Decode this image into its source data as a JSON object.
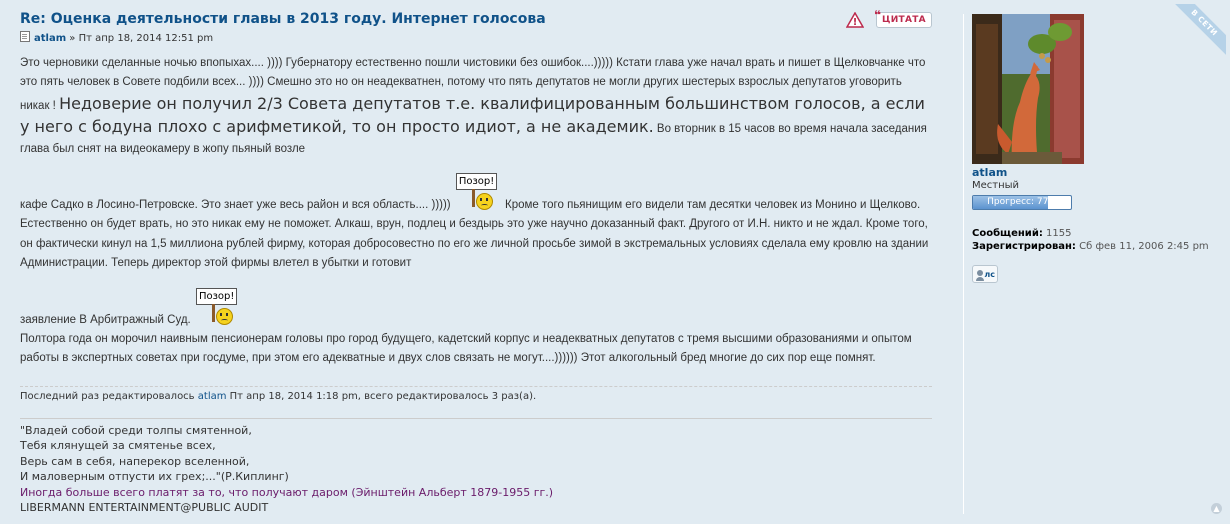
{
  "post": {
    "title": "Re: Оценка деятельности главы в 2013 году. Интернет голосова",
    "author": "atlam",
    "date_sep": " » ",
    "date": "Пт апр 18, 2014 12:51 pm",
    "quote_label": "ЦИТАТА",
    "report_label": "!",
    "content": {
      "p1": "Это черновики сделанные ночью впопыхах.... )))) Губернатору естественно пошли чистовики без ошибок....))))) Кстати глава уже начал врать и пишет в Щелковчанке что это пять человек в Совете подбили всех... )))) Смешно это но он неадекватнен, потому что пять депутатов не могли других шестерых взрослых депутатов уговорить никак ! ",
      "p1_big": "Недоверие он получил 2/3 Совета депутатов т.е. квалифицированным большинством голосов, а если у него с бодуна плохо с арифметикой, то он просто идиот, а не академик.",
      "p1_tail": " Во вторник в 15 часов во время начала заседания глава был снят на видеокамеру в жопу пьяный возле",
      "p2": "кафе Садко в Лосино-Петровске. Это знает уже весь район и вся область.... )))))",
      "smiley_label": "Позор!",
      "p2_tail": " Кроме того пьянищим его видели там десятки человек из Монино и Щелково. Естественно он будет врать, но это никак ему не поможет. Алкаш, врун, подлец и бездырь это уже научно доказанный факт. Другого от И.Н. никто и не ждал. Кроме того, он фактически кинул на 1,5 миллиона рублей фирму, которая добросовестно по его же личной просьбе зимой в экстремальных условиях сделала ему кровлю на здании Администрации. Теперь директор этой фирмы влетел в убытки и готовит",
      "p3": "заявление В Арбитражный Суд.",
      "p4": "Полтора года он морочил наивным пенсионерам головы про город будущего, кадетский корпус и неадекватных депутатов с тремя высшими образованиями и опытом работы в экспертных советах при госдуме, при этом его адекватные и двух слов связать не могут....)))))) Этот алкогольный бред многие до сих пор еще помнят."
    },
    "notice": {
      "prefix": "Последний раз редактировалось ",
      "user": "atlam",
      "suffix": " Пт апр 18, 2014 1:18 pm, всего редактировалось 3 раз(а)."
    },
    "signature": {
      "lines": [
        "\"Владей собой среди толпы смятенной,",
        "Тебя клянущей за смятенье всех,",
        "Верь сам в себя, наперекор вселенной,",
        "И маловерным отпусти их грех;...\"(Р.Киплинг)"
      ],
      "purple_line": "Иногда больше всего платят за то, что получают даром (Эйнштейн Альберт 1879-1955 гг.)",
      "last_line": "LIBERMANN ENTERTAINMENT@PUBLIC AUDIT"
    }
  },
  "profile": {
    "online_label": "В СЕТИ",
    "username": "atlam",
    "rank": "Местный",
    "progress_label": "Прогресс: 77%",
    "progress_value": 0.77,
    "posts_label": "Сообщений:",
    "posts_value": "1155",
    "registered_label": "Зарегистрирован:",
    "registered_value": "Сб фев 11, 2006 2:45 pm",
    "pm_label": "лс"
  },
  "colors": {
    "background": "#e1ebf2",
    "link": "#105289",
    "quote": "#bc2a4d",
    "signature_purple": "#6a1b6a"
  },
  "icons": [
    "post-icon",
    "report-icon",
    "quote-icon",
    "pm-icon",
    "back-to-top-icon"
  ]
}
